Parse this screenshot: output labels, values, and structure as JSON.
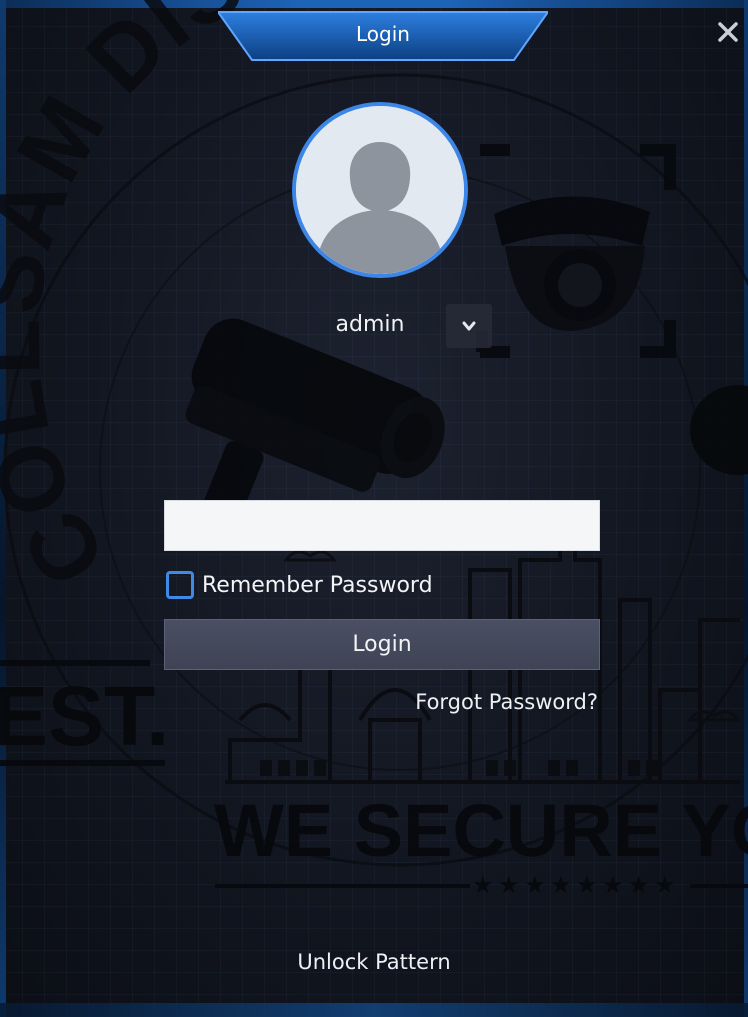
{
  "dialog": {
    "title": "Login"
  },
  "watermark": {
    "arc_text": "COLLSAM DISTRIB",
    "side_text": "EST.",
    "slogan": "WE SECURE YOU"
  },
  "user": {
    "name": "admin"
  },
  "password_field": {
    "value": "",
    "placeholder": ""
  },
  "remember": {
    "label": "Remember Password",
    "checked": false
  },
  "actions": {
    "login_label": "Login",
    "forgot_label": "Forgot Password?",
    "unlock_label": "Unlock Pattern"
  },
  "colors": {
    "accent": "#3b86e6",
    "title_tab": "#1a5fb4",
    "background": "#121620"
  },
  "icons": {
    "close": "close-icon",
    "dropdown": "chevron-down-icon",
    "avatar": "user-silhouette-icon"
  }
}
